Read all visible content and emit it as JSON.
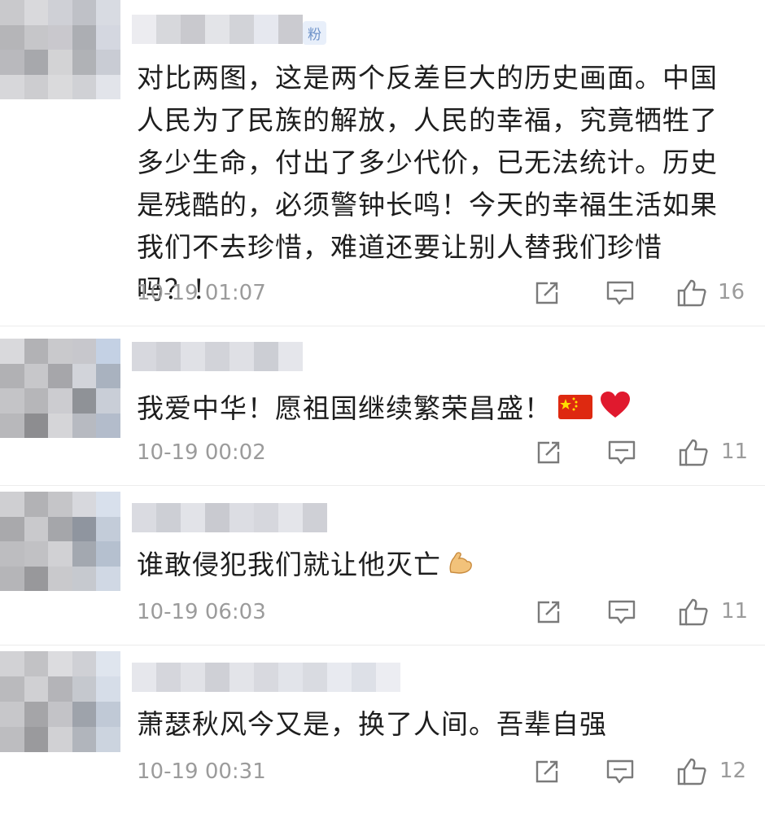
{
  "comments": [
    {
      "badge": "粉",
      "text": "对比两图，这是两个反差巨大的历史画面。中国人民为了民族的解放，人民的幸福，究竟牺牲了多少生命，付出了多少代价，已无法统计。历史是残酷的，必须警钟长鸣！今天的幸福生活如果我们不去珍惜，难道还要让别人替我们珍惜吗？！",
      "time": "10-19 01:07",
      "likes": "16"
    },
    {
      "text": "我爱中华！愿祖国继续繁荣昌盛！",
      "time": "10-19 00:02",
      "likes": "11"
    },
    {
      "text": "谁敢侵犯我们就让他灭亡",
      "time": "10-19 06:03",
      "likes": "11"
    },
    {
      "text": "萧瑟秋风今又是，换了人间。吾辈自强",
      "time": "10-19 00:31",
      "likes": "12"
    }
  ],
  "icons": {
    "share": "share-icon",
    "reply": "reply-icon",
    "like": "thumbs-up-icon",
    "flag": "china-flag-icon",
    "heart": "red-heart-icon",
    "muscle": "flexed-biceps-icon"
  },
  "colors": {
    "time": "#9b9b9b",
    "text": "#1e1e1e",
    "heart": "#e0192e",
    "flag": "#de2910"
  }
}
